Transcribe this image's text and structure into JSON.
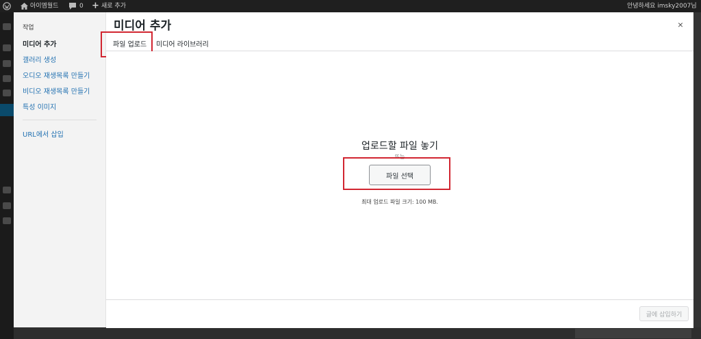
{
  "admin_bar": {
    "site_name": "아이엠월드",
    "comments_count": "0",
    "new_label": "새로 추가",
    "greeting": "안녕하세요 imsky2007님"
  },
  "modal": {
    "title": "미디어 추가",
    "close_label": "×",
    "menu": {
      "heading": "작업",
      "items": [
        {
          "label": "미디어 추가"
        },
        {
          "label": "갤러리 생성"
        },
        {
          "label": "오디오 재생목록 만들기"
        },
        {
          "label": "비디오 재생목록 만들기"
        },
        {
          "label": "특성 이미지"
        }
      ],
      "url_insert": "URL에서 삽입"
    },
    "tabs": [
      {
        "label": "파일 업로드"
      },
      {
        "label": "미디어 라이브러리"
      }
    ],
    "upload": {
      "drop_title": "업로드할 파일 놓기",
      "or_text": "또는",
      "select_button": "파일 선택",
      "max_size": "최대 업로드 파일 크기: 100 MB."
    },
    "toolbar": {
      "insert_button": "글에 삽입하기"
    }
  },
  "colors": {
    "highlight": "#d1242f",
    "link": "#2271b1",
    "admin_bar_bg": "#1f1f1f"
  }
}
